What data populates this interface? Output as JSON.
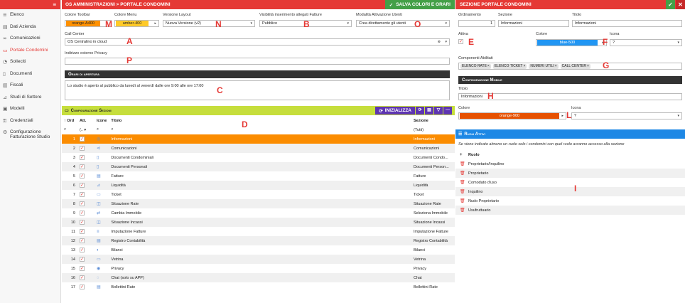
{
  "sidebar": {
    "items": [
      {
        "icon": "list-icon",
        "glyph": "≡",
        "label": "Elenco"
      },
      {
        "icon": "id-card-icon",
        "glyph": "▤",
        "label": "Dati Azienda"
      },
      {
        "icon": "chat-icon",
        "glyph": "∞",
        "label": "Comunicazioni"
      },
      {
        "icon": "portal-icon",
        "glyph": "▭",
        "label": "Portale Condomini"
      },
      {
        "icon": "refresh-icon",
        "glyph": "◔",
        "label": "Solleciti"
      },
      {
        "icon": "document-icon",
        "glyph": "▯",
        "label": "Documenti"
      },
      {
        "icon": "fiscal-icon",
        "glyph": "▥",
        "label": "Fiscali"
      },
      {
        "icon": "chart-icon",
        "glyph": "⊿",
        "label": "Studi di Settore"
      },
      {
        "icon": "template-icon",
        "glyph": "▣",
        "label": "Modelli"
      },
      {
        "icon": "key-icon",
        "glyph": "⚿",
        "label": "Credenziali"
      },
      {
        "icon": "settings-icon",
        "glyph": "⚙",
        "label": "Configurazione Fatturazione Studio"
      }
    ]
  },
  "header": {
    "breadcrumb": "OS AMMINISTRAZIONI > PORTALE CONDOMINI",
    "save_label": "SALVA COLORI E ORARI",
    "check_glyph": "✓"
  },
  "form": {
    "toolbar_color": {
      "label": "Colore Toolbar",
      "value": "orange-A400",
      "color": "#ff9100"
    },
    "menu_color": {
      "label": "Colore Menu",
      "value": "amber-400",
      "color": "#ffca28"
    },
    "layout_version": {
      "label": "Versione Layout",
      "value": "Nuova Versione (v2)"
    },
    "attach_visibility": {
      "label": "Visibilità inserimento allegati Fatture",
      "value": "Pubblico"
    },
    "user_activation": {
      "label": "Modalità Attivazione Utenti",
      "value": "Crea direttamente gli utenti"
    },
    "call_center": {
      "label": "Call Center",
      "value": "OS Centralino in cloud"
    },
    "privacy_address": {
      "label": "Indirizzo esterno Privacy",
      "value": ""
    },
    "hours_title": "Orari di apertura",
    "hours_text": "Lo studio è aperto al pubblico da lunedì al venerdì dalle ore 9:00 alle ore 17:00"
  },
  "markers": {
    "M": "M",
    "N": "N",
    "B": "B",
    "O": "O",
    "A": "A",
    "P": "P",
    "C": "C",
    "D": "D",
    "E": "E",
    "F": "F",
    "G": "G",
    "H": "H",
    "L": "L",
    "I": "I"
  },
  "sections": {
    "title": "Configurazione Sezioni",
    "init_label": "INIZIALIZZA",
    "columns": {
      "ord": "Ord",
      "att": "Att.",
      "icon": "Icone",
      "title": "Titolo",
      "section": "Sezione"
    },
    "filter_all": "(Tutti)",
    "rows": [
      {
        "ord": "1",
        "title": "Informazioni",
        "section": "Informazioni",
        "glyph": "◎"
      },
      {
        "ord": "2",
        "title": "Comunicazioni",
        "section": "Comunicazioni",
        "glyph": "⊲"
      },
      {
        "ord": "3",
        "title": "Documenti Condominiali",
        "section": "Documenti Condo...",
        "glyph": "▯"
      },
      {
        "ord": "4",
        "title": "Documenti Personali",
        "section": "Documenti Person...",
        "glyph": "▯"
      },
      {
        "ord": "5",
        "title": "Fatture",
        "section": "Fatture",
        "glyph": "▤"
      },
      {
        "ord": "6",
        "title": "Liquidità",
        "section": "Liquidità",
        "glyph": "⊿"
      },
      {
        "ord": "7",
        "title": "Ticket",
        "section": "Ticket",
        "glyph": "▭"
      },
      {
        "ord": "8",
        "title": "Situazione Rate",
        "section": "Situazione Rate",
        "glyph": "◫"
      },
      {
        "ord": "9",
        "title": "Cambia Immobile",
        "section": "Seleziona Immobile",
        "glyph": "⇄"
      },
      {
        "ord": "10",
        "title": "Situazione Incassi",
        "section": "Situazione Incassi",
        "glyph": "◫"
      },
      {
        "ord": "11",
        "title": "Imputazione Fatture",
        "section": "Imputazione Fatture",
        "glyph": "≡"
      },
      {
        "ord": "12",
        "title": "Registro Contabilità",
        "section": "Registro Contabilità",
        "glyph": "▤"
      },
      {
        "ord": "13",
        "title": "Bilanci",
        "section": "Bilanci",
        "glyph": "◐"
      },
      {
        "ord": "14",
        "title": "Vetrina",
        "section": "Vetrina",
        "glyph": "▭"
      },
      {
        "ord": "15",
        "title": "Privacy",
        "section": "Privacy",
        "glyph": "◉"
      },
      {
        "ord": "16",
        "title": "Chat (solo su APP)",
        "section": "Chat",
        "glyph": "◌"
      },
      {
        "ord": "17",
        "title": "Bollettini Rate",
        "section": "Bollettini Rate",
        "glyph": "▤"
      }
    ]
  },
  "detail": {
    "title": "SEZIONE PORTALE CONDOMINI",
    "ordinamento": {
      "label": "Ordinamento",
      "value": "1"
    },
    "sezione": {
      "label": "Sezione",
      "value": "Informazioni"
    },
    "titolo": {
      "label": "Titolo",
      "value": "Informazioni"
    },
    "attiva": {
      "label": "Attiva"
    },
    "colore": {
      "label": "Colore",
      "value": "blue-500",
      "color": "#2196f3"
    },
    "icona": {
      "label": "Icona",
      "value": "?"
    },
    "componenti": {
      "label": "Componenti Abilitati",
      "chips": [
        "ELENCO RATE",
        "ELENCO TICKET",
        "NUMERI UTILI",
        "CALL CENTER"
      ]
    },
    "mobile_title": "Configurazione Mobile",
    "mobile_titolo": {
      "label": "Titolo",
      "value": "Informazioni"
    },
    "mobile_colore": {
      "label": "Colore",
      "value": "orange-900",
      "color": "#e65100"
    },
    "mobile_icona": {
      "label": "Icona",
      "value": "?"
    },
    "roles_title": "Ruoli Attivi",
    "roles_note": "Se viene indicato almeno un ruolo solo i condomini con quel ruolo avranno accesso alla sezione",
    "roles_col": "Ruolo",
    "roles": [
      "Proprietario/Inquilino",
      "Proprietario",
      "Comodato d'uso",
      "Inquilino",
      "Nudo Proprietario",
      "Usufruttuario"
    ]
  }
}
